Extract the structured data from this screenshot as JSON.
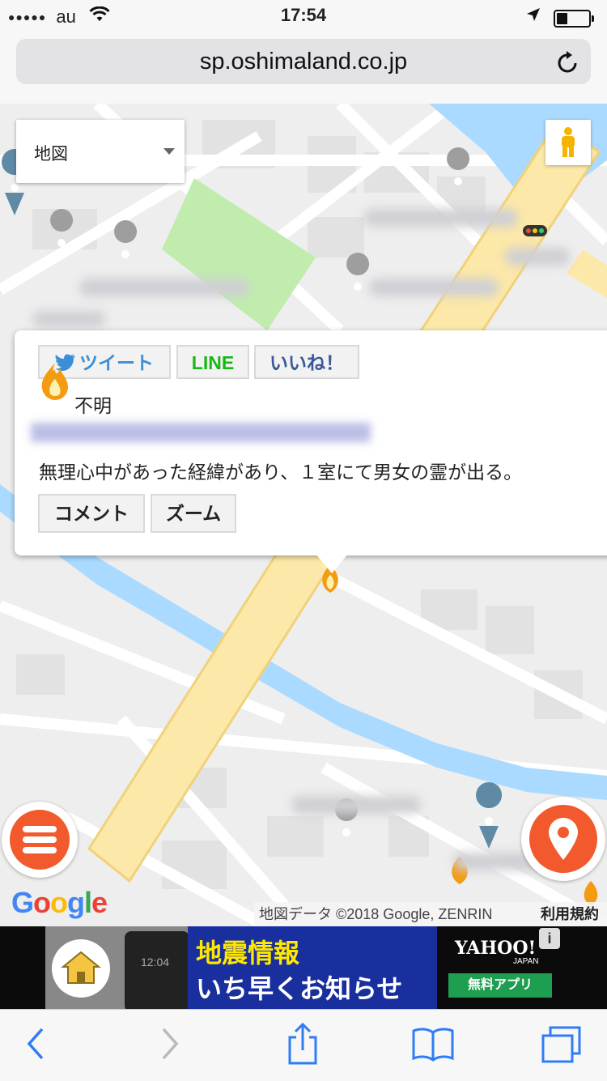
{
  "status_bar": {
    "signal_dots": "●●●●●",
    "carrier": "au",
    "time": "17:54",
    "battery_level": 0.35
  },
  "browser": {
    "url": "sp.oshimaland.co.jp"
  },
  "map": {
    "map_type": "地図",
    "info_window": {
      "tweet_label": "ツイート",
      "line_label": "LINE",
      "like_label": "いいね！",
      "level_text": "不明",
      "description": "無理心中があった経緯があり、１室にて男女の霊が出る。",
      "comment_label": "コメント",
      "zoom_label": "ズーム"
    },
    "google_logo": [
      "G",
      "o",
      "o",
      "g",
      "l",
      "e"
    ],
    "attribution": "地図データ ©2018 Google, ZENRIN",
    "terms": "利用規約"
  },
  "banner": {
    "phone_time": "12:04",
    "title": "地震情報",
    "subtitle": "いち早くお知らせ",
    "brand": "YAHOO!",
    "brand_sub": "JAPAN",
    "cta": "無料アプリ",
    "info_mark": "i"
  },
  "colors": {
    "accent": "#f25a2e",
    "twitter": "#3b8fd6",
    "line": "#16b816",
    "facebook": "#3b5998",
    "safari_blue": "#2f7cf6"
  }
}
